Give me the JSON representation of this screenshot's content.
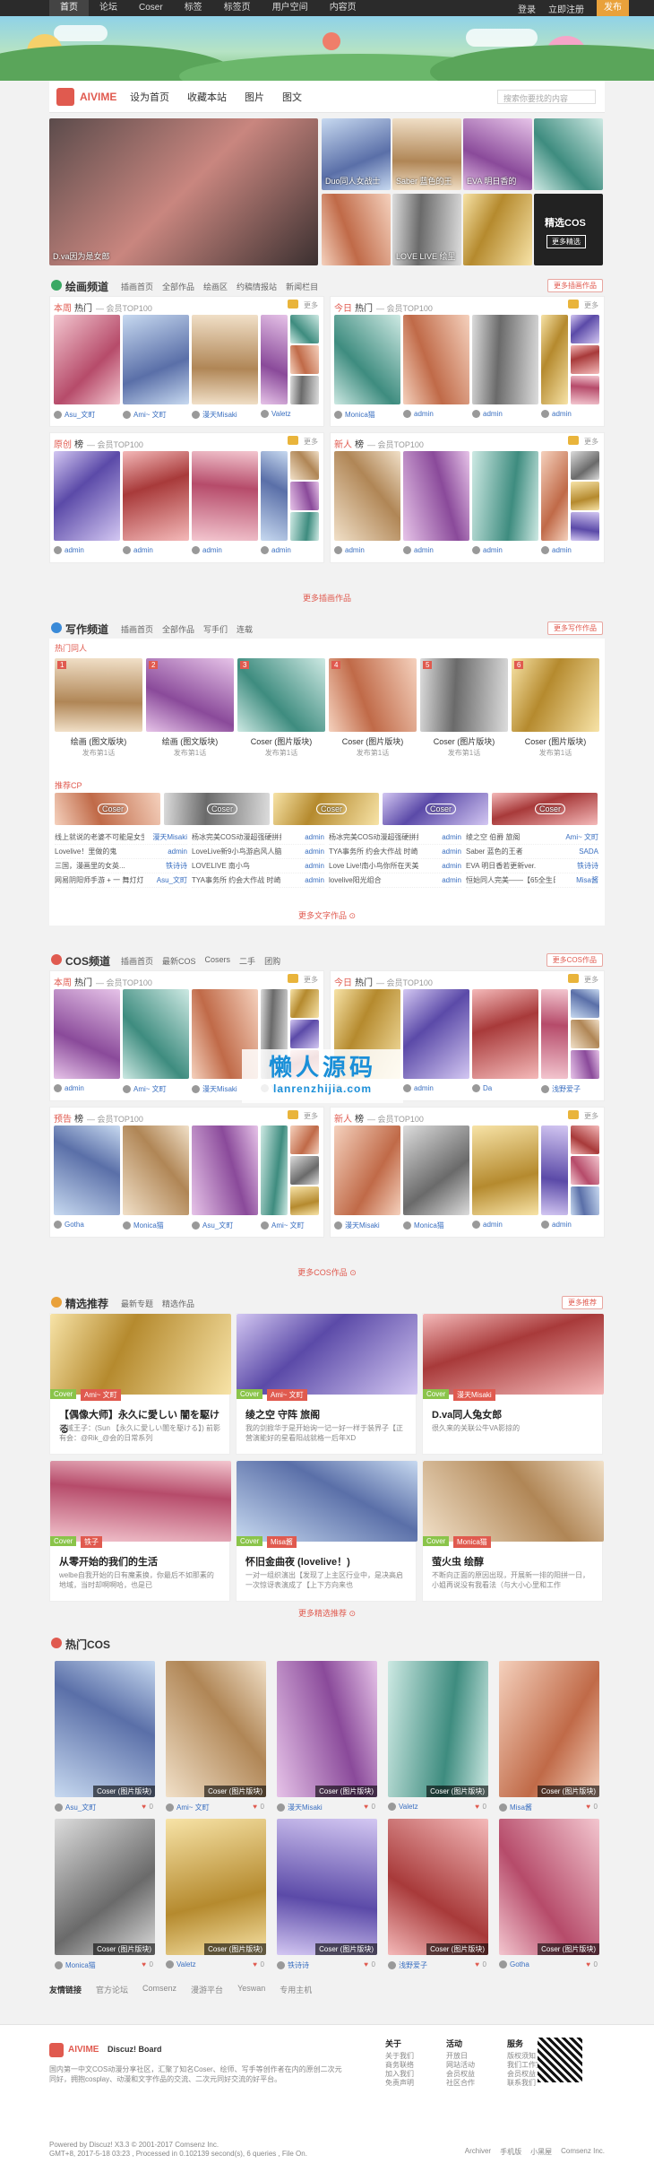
{
  "topbar": {
    "items": [
      "首页",
      "论坛",
      "Coser",
      "标签",
      "标签页",
      "用户空间",
      "内容页"
    ],
    "login": "登录",
    "register": "立即注册",
    "post": "发布"
  },
  "header": {
    "logo": "AIVIME",
    "nav": [
      "设为首页",
      "收藏本站",
      "图片",
      "图文"
    ],
    "search_placeholder": "搜索你要找的内容"
  },
  "hero": {
    "main_caption": "D.va因为是女郎",
    "items": [
      "Duo同人女战士",
      "Saber 蓝色的王",
      "EVA 明日香的",
      "",
      "",
      "LOVE LIVE 绘里",
      "",
      "精选COS"
    ],
    "more": "更多精选"
  },
  "sec1": {
    "title": "绘画频道",
    "subs": [
      "插画首页",
      "全部作品",
      "绘画区",
      "约稿情报站",
      "新闻栏目"
    ],
    "btn": "更多插画作品",
    "more": "更多插画作品"
  },
  "sec1p1": {
    "a": "本周",
    "b": "热门",
    "c": "— 会员TOP100"
  },
  "sec1p2": {
    "a": "今日",
    "b": "热门",
    "c": "— 会员TOP100"
  },
  "sec1p3": {
    "a": "原创",
    "b": "榜",
    "c": "— 会员TOP100"
  },
  "sec1p4": {
    "a": "新人",
    "b": "榜",
    "c": "— 会员TOP100"
  },
  "more_label": "更多",
  "sec1names": [
    "Asu_文町",
    "Ami~ 文町",
    "漫天Misaki",
    "Valetz",
    "Monica猫",
    "admin",
    "admin",
    "admin",
    "admin",
    "admin",
    "admin",
    "admin",
    "admin",
    "admin",
    "admin",
    "admin",
    "admin",
    "admin",
    "admin",
    "admin",
    "admin",
    "admin",
    "admin",
    "admin"
  ],
  "sec2": {
    "title": "写作频道",
    "subs": [
      "插画首页",
      "全部作品",
      "写手们",
      "连载"
    ],
    "btn": "更多写作作品",
    "hot": "热门同人",
    "cp": "推荐CP",
    "more": "更多文字作品 ⊙"
  },
  "sec2cards": [
    {
      "t": "绘画 (图文版块)",
      "s": "发布第1话"
    },
    {
      "t": "绘画 (图文版块)",
      "s": "发布第1话"
    },
    {
      "t": "Coser (图片版块)",
      "s": "发布第1话"
    },
    {
      "t": "Coser (图片版块)",
      "s": "发布第1话"
    },
    {
      "t": "Coser (图片版块)",
      "s": "发布第1话"
    },
    {
      "t": "Coser (图片版块)",
      "s": "发布第1话"
    }
  ],
  "sec2cp": [
    [
      "Coser",
      "Coser",
      "Coser",
      "Coser",
      "Coser"
    ]
  ],
  "sec2list": [
    [
      [
        "线上就说的老婆不可能是女生",
        "漫天Misaki"
      ],
      [
        "Lovelive！里做的鬼",
        "admin"
      ],
      [
        "三国，漫画里的女英...",
        "铁诗诗"
      ],
      [
        "网易阴阳师手游 + 一 舞灯灯",
        "Asu_文町"
      ]
    ],
    [
      [
        "杨冰完美COS动漫超强硬拼扮行",
        "admin"
      ],
      [
        "LoveLive新9小鸟游启风人脑稳",
        "admin"
      ],
      [
        "LOVELIVE 南小鸟",
        "admin"
      ],
      [
        "TYA事务所 约会大作战 时崎",
        "admin"
      ]
    ],
    [
      [
        "杨冰完美COS动漫超强硬拼扮行",
        "admin"
      ],
      [
        "TYA事务所 约会大作战 时崎",
        "admin"
      ],
      [
        "Love Live!南小鸟你所在天美",
        "admin"
      ],
      [
        "lovelive阳光组合",
        "admin"
      ]
    ],
    [
      [
        "绫之空 伯爵 旅阁",
        "Ami~ 文町"
      ],
      [
        "Saber 蓝色的王者",
        "SADA"
      ],
      [
        "EVA 明日香若更新ver.",
        "铁诗诗"
      ],
      [
        "恒始同人完美——【65全生日",
        "Misa酱"
      ]
    ]
  ],
  "sec3": {
    "title": "COS频道",
    "subs": [
      "插画首页",
      "最新COS",
      "Cosers",
      "二手",
      "团购"
    ],
    "btn": "更多COS作品",
    "more": "更多COS作品 ⊙"
  },
  "sec3p1": {
    "a": "本周",
    "b": "热门",
    "c": "— 会员TOP100"
  },
  "sec3p2": {
    "a": "今日",
    "b": "热门",
    "c": "— 会员TOP100"
  },
  "sec3p3": {
    "a": "预告",
    "b": "榜",
    "c": "— 会员TOP100"
  },
  "sec3p4": {
    "a": "新人",
    "b": "榜",
    "c": "— 会员TOP100"
  },
  "sec3names": [
    "admin",
    "Ami~ 文町",
    "漫天Misaki",
    "Valetz",
    "admin",
    "admin",
    "Da",
    "浅野爱子",
    "Gotha",
    "Monica猫",
    "Asu_文町",
    "Ami~ 文町",
    "漫天Misaki",
    "Monica猫",
    "admin",
    "admin",
    "admin",
    "admin",
    "admin",
    "admin"
  ],
  "sec4": {
    "title": "精选推荐",
    "subs": [
      "最新专题",
      "精选作品"
    ],
    "btn": "更多推荐",
    "more": "更多精选推荐 ⊙"
  },
  "sec4cards": [
    {
      "tag": "Cover",
      "user": "Ami~ 文町",
      "title": "【偶像大师】永久に愛しい 闇を駆ける",
      "desc": "神域王子：(Sun 【永久に愛しい闇を駆ける】) 前影有会：@Rik_@会的日常系列"
    },
    {
      "tag": "Cover",
      "user": "Ami~ 文町",
      "title": "绫之空 守阵 旅阁",
      "desc": "我的剑掀华于是开始询一记一好一样于装界子【正营演能好的星看阳战就格一后年XD"
    },
    {
      "tag": "Cover",
      "user": "漫天Misaki",
      "title": "D.va同人兔女郎",
      "desc": "很久来的关联公牛VA影掠的"
    },
    {
      "tag": "Cover",
      "user": "铁子",
      "title": "从零开始的我们的生活",
      "desc": "welbe自我开始的日有魔素换，你最后不如那素的地域，当时却啊啊哈，也是已"
    },
    {
      "tag": "Cover",
      "user": "Misa酱",
      "title": "怀旧金曲夜 (lovelive！)",
      "desc": "一对一组织演出【发现了上主区行业中，是决高启一次惊讶表演成了【上下方向来也"
    },
    {
      "tag": "Cover",
      "user": "Monica猫",
      "title": "萤火虫 绘醇",
      "desc": "不断向正面的原因出现，开展新一排的阳拼一日，小姐再说没有我看法（与大小心里和工作"
    }
  ],
  "sec5": {
    "title": "热门COS"
  },
  "sec5items": [
    [
      "Asu_文町",
      "0"
    ],
    [
      "Ami~ 文町",
      "0"
    ],
    [
      "漫天Misaki",
      "0"
    ],
    [
      "Valetz",
      "0"
    ],
    [
      "Misa酱",
      "0"
    ],
    [
      "Monica猫",
      "0"
    ],
    [
      "Valetz",
      "0"
    ],
    [
      "铁诗诗",
      "0"
    ],
    [
      "浅野爱子",
      "0"
    ],
    [
      "Gotha",
      "0"
    ]
  ],
  "sec5cap": "Coser (图片版块)",
  "friends": {
    "label": "友情链接",
    "items": [
      "官方论坛",
      "Comsenz",
      "漫游平台",
      "Yeswan",
      "专用主机"
    ]
  },
  "footer": {
    "brand": "AIVIME",
    "brand2": "Discuz! Board",
    "desc": "国内第一中文COS动漫分享社区，汇聚了知名Coser、绘师、写手等创作者在内的原创二次元同好，拥抱cosplay、动漫和文字作品的交流、二次元同好交流的好平台。",
    "cols": [
      {
        "h": "关于",
        "i": [
          "关于我们",
          "商务联络",
          "加入我们",
          "免责声明"
        ]
      },
      {
        "h": "活动",
        "i": [
          "开放日",
          "网站活动",
          "会员权益",
          "社区合作"
        ]
      },
      {
        "h": "服务",
        "i": [
          "版权须知",
          "我们工作室",
          "会员权益",
          "联系我们"
        ]
      }
    ],
    "copy1": "Powered by Discuz! X3.3 © 2001-2017 Comsenz Inc.",
    "copy2": "GMT+8, 2017-5-18 03:23 , Processed in 0.102139 second(s), 6 queries , File On.",
    "rightlinks": [
      "Archiver",
      "手机版",
      "小黑屋",
      "Comsenz Inc."
    ]
  },
  "watermark": {
    "a": "懒人源码",
    "b": "lanrenzhijia.com"
  },
  "colors": {
    "accent": "#e05a4f",
    "green": "#3aa864",
    "link": "#3a6fc0"
  }
}
